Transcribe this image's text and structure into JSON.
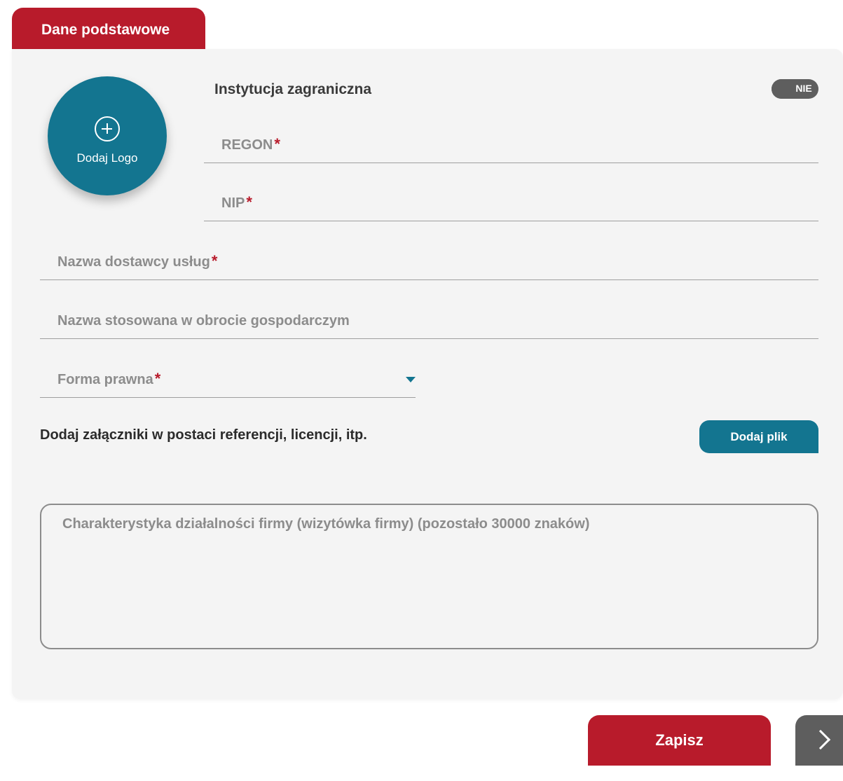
{
  "tab": {
    "label": "Dane podstawowe"
  },
  "logo": {
    "label": "Dodaj Logo",
    "icon": "plus-circle-icon"
  },
  "foreign": {
    "label": "Instytucja zagraniczna",
    "toggle_value": "NIE"
  },
  "fields": {
    "regon": {
      "label": "REGON",
      "required_mark": "*"
    },
    "nip": {
      "label": "NIP",
      "required_mark": "*"
    },
    "provider_name": {
      "label": "Nazwa dostawcy usług",
      "required_mark": "*"
    },
    "trade_name": {
      "label": "Nazwa stosowana w obrocie gospodarczym"
    },
    "legal_form": {
      "label": "Forma prawna",
      "required_mark": "*",
      "icon": "caret-down-icon"
    }
  },
  "attachments": {
    "label": "Dodaj załączniki w postaci referencji, licencji, itp.",
    "button_label": "Dodaj plik"
  },
  "description": {
    "placeholder": "Charakterystyka działalności firmy (wizytówka firmy) (pozostało 30000 znaków)"
  },
  "footer": {
    "save_label": "Zapisz",
    "next_icon": "chevron-right-icon"
  },
  "colors": {
    "primary_red": "#b81b2b",
    "primary_teal": "#137590",
    "toggle_gray": "#5e5e5e"
  }
}
